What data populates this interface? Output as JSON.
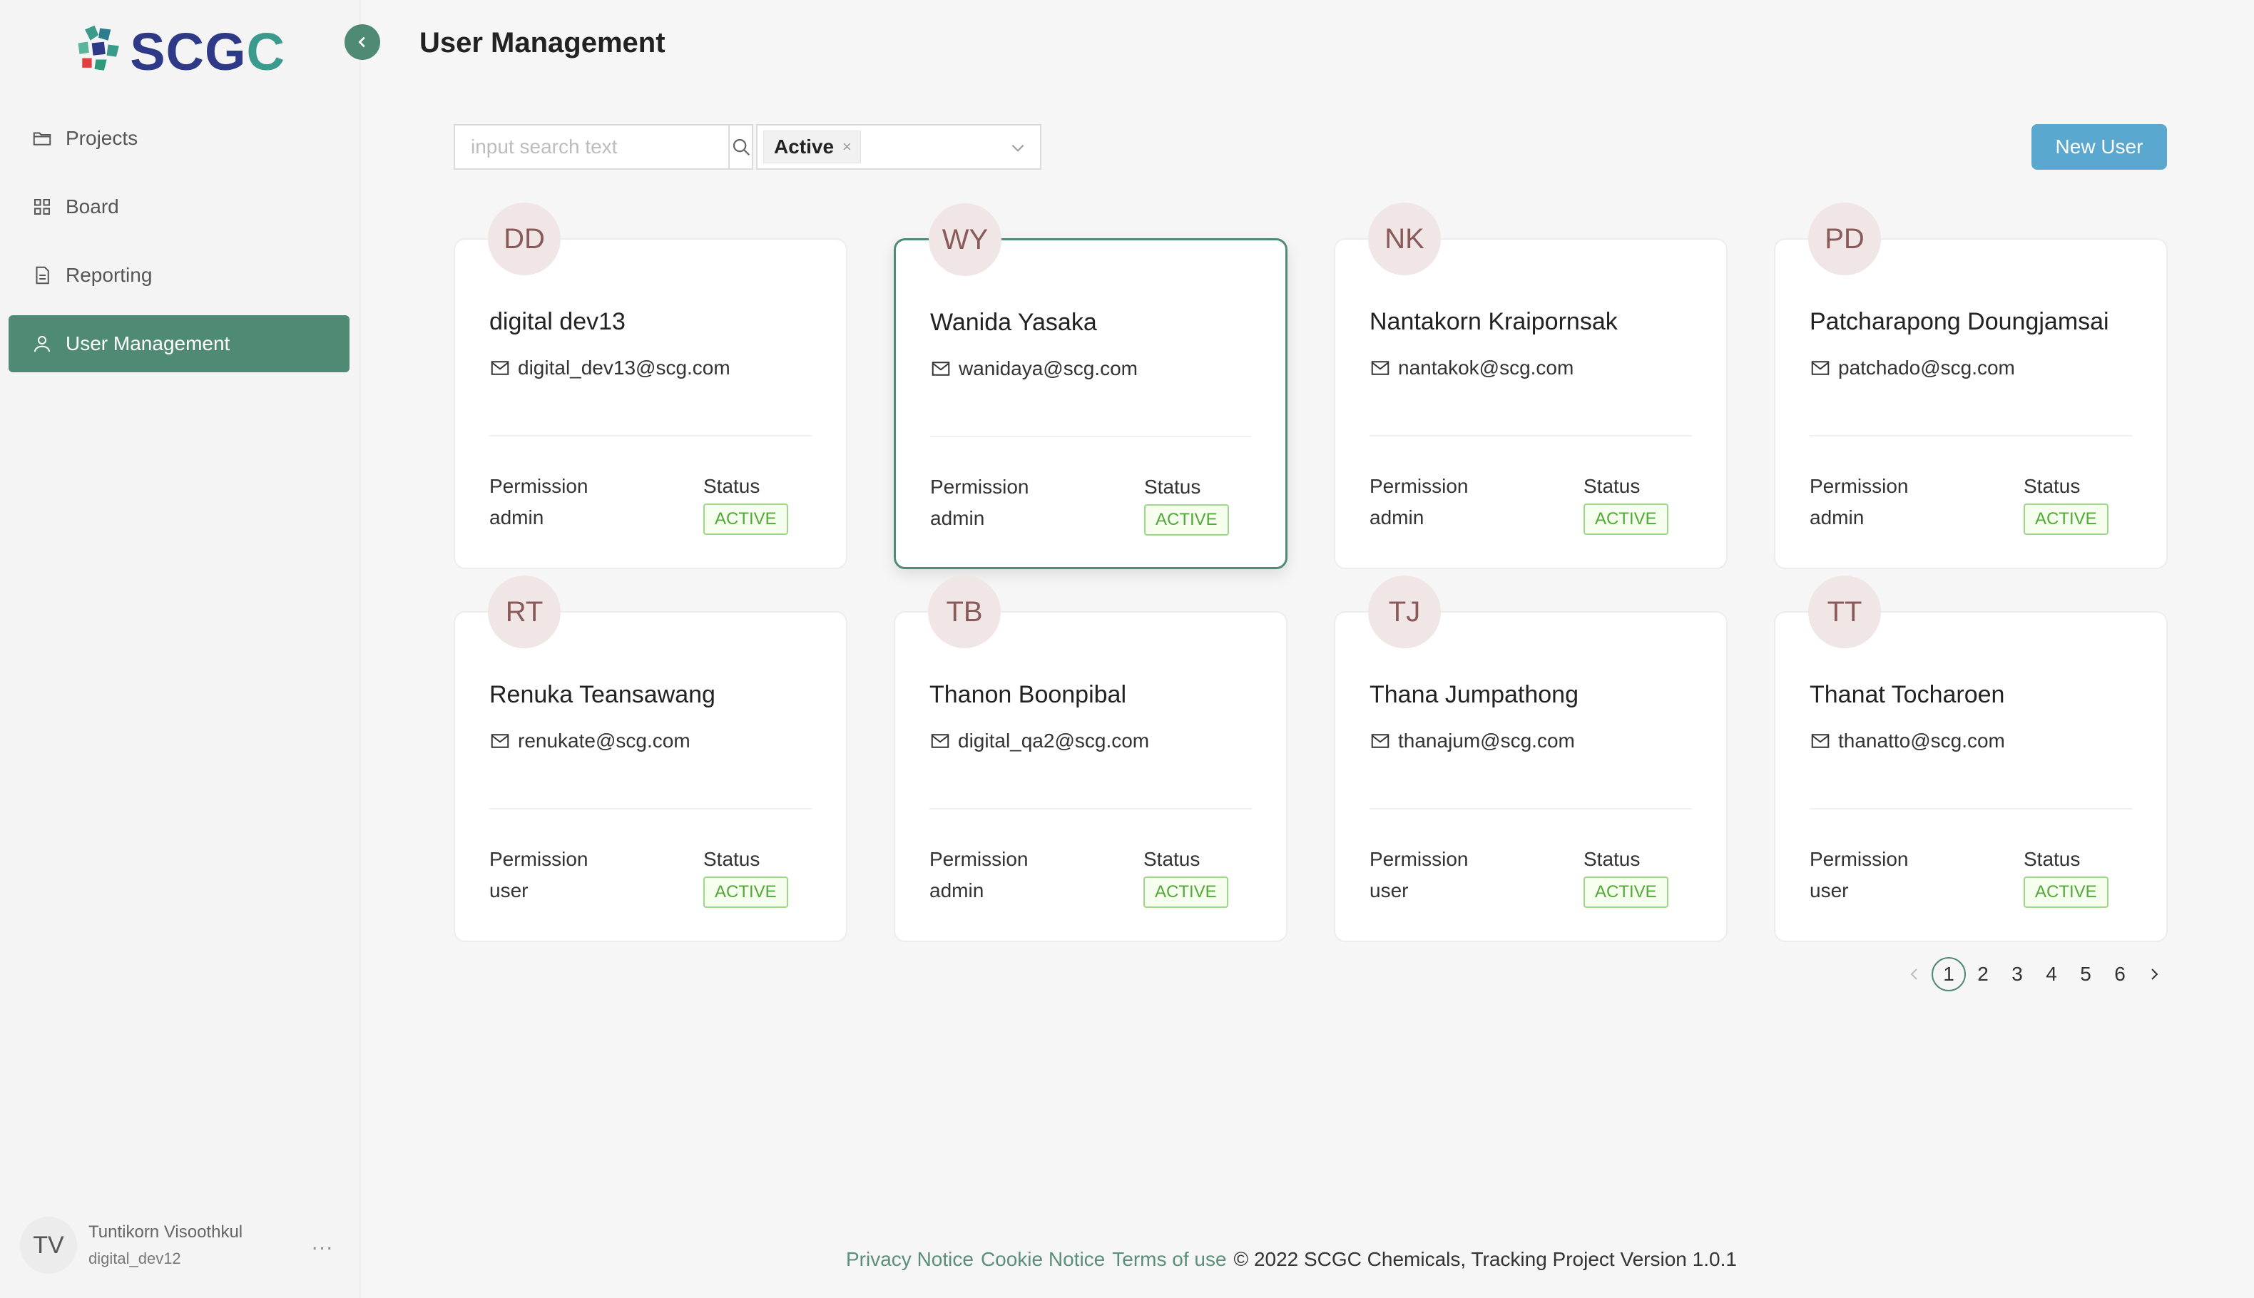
{
  "app": {
    "logo_text": "SCGC",
    "logo_part1": "SCG",
    "logo_part2": "C"
  },
  "sidebar": {
    "items": [
      {
        "label": "Projects",
        "icon": "folder-icon"
      },
      {
        "label": "Board",
        "icon": "grid-icon"
      },
      {
        "label": "Reporting",
        "icon": "document-icon"
      },
      {
        "label": "User Management",
        "icon": "user-icon",
        "active": true
      }
    ],
    "current_user": {
      "initials": "TV",
      "name": "Tuntikorn Visoothkul",
      "login": "digital_dev12",
      "more": "..."
    }
  },
  "header": {
    "title": "User Management"
  },
  "toolbar": {
    "search_placeholder": "input search text",
    "status_filter_tag": "Active",
    "tag_close": "×",
    "new_user_label": "New User"
  },
  "labels": {
    "permission": "Permission",
    "status": "Status"
  },
  "users": [
    {
      "initials": "DD",
      "name": "digital dev13",
      "email": "digital_dev13@scg.com",
      "permission": "admin",
      "status": "ACTIVE"
    },
    {
      "initials": "WY",
      "name": "Wanida Yasaka",
      "email": "wanidaya@scg.com",
      "permission": "admin",
      "status": "ACTIVE",
      "selected": true
    },
    {
      "initials": "NK",
      "name": "Nantakorn Kraipornsak",
      "email": "nantakok@scg.com",
      "permission": "admin",
      "status": "ACTIVE"
    },
    {
      "initials": "PD",
      "name": "Patcharapong Doungjamsai",
      "email": "patchado@scg.com",
      "permission": "admin",
      "status": "ACTIVE"
    },
    {
      "initials": "RT",
      "name": "Renuka Teansawang",
      "email": "renukate@scg.com",
      "permission": "user",
      "status": "ACTIVE"
    },
    {
      "initials": "TB",
      "name": "Thanon Boonpibal",
      "email": "digital_qa2@scg.com",
      "permission": "admin",
      "status": "ACTIVE"
    },
    {
      "initials": "TJ",
      "name": "Thana Jumpathong",
      "email": "thanajum@scg.com",
      "permission": "user",
      "status": "ACTIVE"
    },
    {
      "initials": "TT",
      "name": "Thanat Tocharoen",
      "email": "thanatto@scg.com",
      "permission": "user",
      "status": "ACTIVE"
    }
  ],
  "pagination": {
    "pages": [
      "1",
      "2",
      "3",
      "4",
      "5",
      "6"
    ],
    "current": "1"
  },
  "footer": {
    "privacy": "Privacy Notice",
    "cookie": "Cookie Notice",
    "terms": "Terms of use",
    "copyright": "© 2022 SCGC Chemicals, Tracking Project Version 1.0.1"
  },
  "colors": {
    "accent": "#4f8a74",
    "primary_button": "#5aa7cf",
    "status_green": "#52a83a",
    "brand_navy": "#2e3a87",
    "brand_teal": "#3a9a8c"
  }
}
